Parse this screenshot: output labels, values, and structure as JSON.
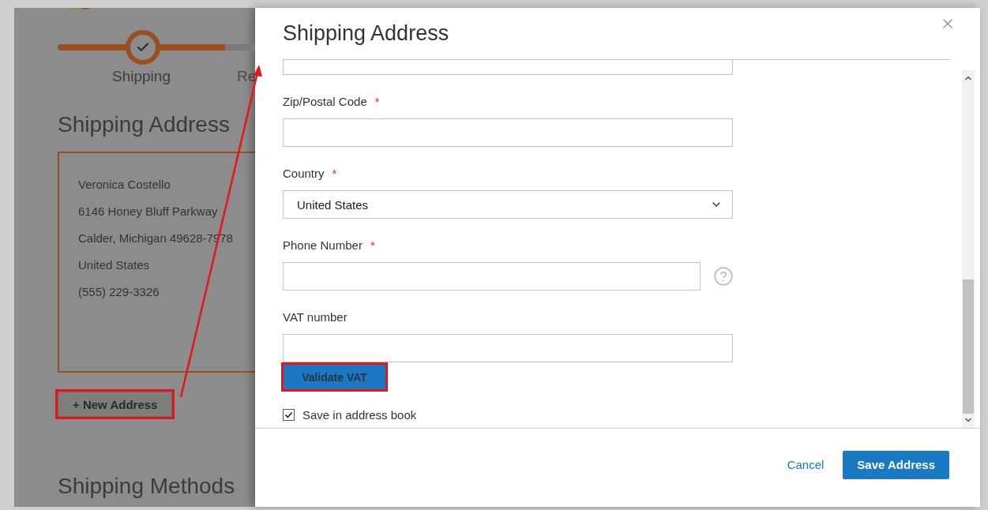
{
  "background_page": {
    "progress": [
      {
        "label": "Shipping",
        "completed": true
      },
      {
        "label": "Re",
        "completed": false
      }
    ],
    "section_title": "Shipping Address",
    "address_card": {
      "selected": true,
      "lines": [
        "Veronica Costello",
        "6146 Honey Bluff Parkway",
        "Calder, Michigan 49628-7978",
        "United States",
        "(555) 229-3326"
      ]
    },
    "new_address_button": {
      "label": "+ New Address",
      "highlighted": true
    },
    "next_section_title": "Shipping Methods"
  },
  "modal": {
    "title": "Shipping Address",
    "fields": [
      {
        "kind": "input"
      },
      {
        "kind": "input",
        "label": "Zip/Postal Code",
        "required_mark": "*"
      },
      {
        "kind": "select",
        "label": "Country",
        "required_mark": "*",
        "value": "United States"
      },
      {
        "kind": "input",
        "label": "Phone Number",
        "required_mark": "*",
        "help": true
      },
      {
        "kind": "input",
        "label": "VAT number"
      }
    ],
    "validate_button": {
      "label": "Validate VAT",
      "highlighted": true
    },
    "save_checkbox": {
      "label": "Save in address book",
      "checked": true
    },
    "footer": {
      "cancel_label": "Cancel",
      "save_label": "Save Address"
    }
  },
  "annotations": [
    {
      "kind": "arrow"
    }
  ]
}
